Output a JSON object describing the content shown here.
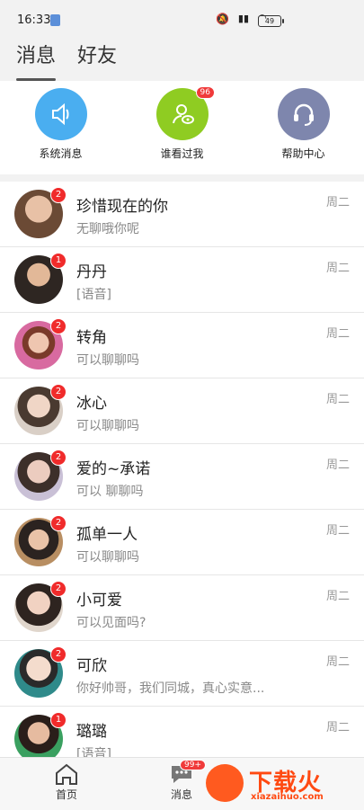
{
  "status": {
    "time": "16:33",
    "battery": "49"
  },
  "tabs": [
    {
      "label": "消息"
    },
    {
      "label": "好友"
    }
  ],
  "quick": {
    "system": {
      "label": "系统消息",
      "color": "#4aaef0"
    },
    "viewers": {
      "label": "谁看过我",
      "badge": "96",
      "color": "#8fcc22"
    },
    "help": {
      "label": "帮助中心",
      "color": "#7e86ad"
    }
  },
  "messages": [
    {
      "name": "珍惜现在的你",
      "preview": "无聊哦你呢",
      "time": "周二",
      "badge": "2"
    },
    {
      "name": "丹丹",
      "preview": "[语音]",
      "time": "周二",
      "badge": "1"
    },
    {
      "name": "转角",
      "preview": "可以聊聊吗",
      "time": "周二",
      "badge": "2"
    },
    {
      "name": "冰心",
      "preview": "可以聊聊吗",
      "time": "周二",
      "badge": "2"
    },
    {
      "name": "爱的~承诺",
      "preview": "可以 聊聊吗",
      "time": "周二",
      "badge": "2"
    },
    {
      "name": "孤单一人",
      "preview": "可以聊聊吗",
      "time": "周二",
      "badge": "2"
    },
    {
      "name": "小可爱",
      "preview": "可以见面吗?",
      "time": "周二",
      "badge": "2"
    },
    {
      "name": "可欣",
      "preview": "你好帅哥，我们同城，真心实意...",
      "time": "周二",
      "badge": "2"
    },
    {
      "name": "璐璐",
      "preview": "[语音]",
      "time": "周二",
      "badge": "1"
    }
  ],
  "nav": {
    "home": {
      "label": "首页"
    },
    "messages": {
      "label": "消息",
      "badge": "99+"
    }
  },
  "watermark": {
    "title": "下载火",
    "sub": "xiazaihuo.com"
  }
}
